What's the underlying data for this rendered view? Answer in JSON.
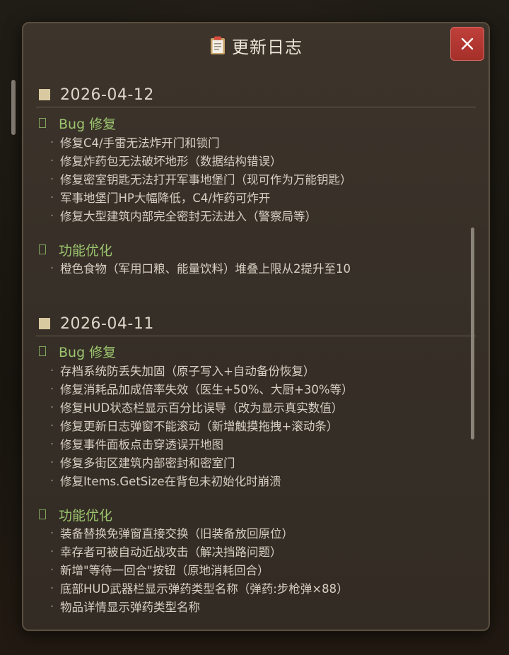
{
  "modal": {
    "title": "更新日志",
    "close_symbol": "✕"
  },
  "icons": {
    "title_icon": "clipboard-icon",
    "close_icon": "close-icon",
    "section_icon": "square-bullet-icon"
  },
  "colors": {
    "panel_bg": "#3a3129",
    "accent_green": "#9cc56e",
    "close_red": "#b3352f",
    "date_square": "#d8c9a0"
  },
  "changelog": [
    {
      "date": "2026-04-12",
      "sections": [
        {
          "title": "Bug 修复",
          "items": [
            "修复C4/手雷无法炸开门和锁门",
            "修复炸药包无法破坏地形（数据结构错误）",
            "修复密室钥匙无法打开军事地堡门（现可作为万能钥匙）",
            "军事地堡门HP大幅降低，C4/炸药可炸开",
            "修复大型建筑内部完全密封无法进入（警察局等）"
          ]
        },
        {
          "title": "功能优化",
          "items": [
            "橙色食物（军用口粮、能量饮料）堆叠上限从2提升至10"
          ]
        }
      ]
    },
    {
      "date": "2026-04-11",
      "sections": [
        {
          "title": "Bug 修复",
          "items": [
            "存档系统防丢失加固（原子写入+自动备份恢复）",
            "修复消耗品加成倍率失效（医生+50%、大厨+30%等）",
            "修复HUD状态栏显示百分比误导（改为显示真实数值）",
            "修复更新日志弹窗不能滚动（新增触摸拖拽+滚动条）",
            "修复事件面板点击穿透误开地图",
            "修复多街区建筑内部密封和密室门",
            "修复Items.GetSize在背包未初始化时崩溃"
          ]
        },
        {
          "title": "功能优化",
          "items": [
            "装备替换免弹窗直接交换（旧装备放回原位）",
            "幸存者可被自动近战攻击（解决挡路问题）",
            "新增\"等待一回合\"按钮（原地消耗回合）",
            "底部HUD武器栏显示弹药类型名称（弹药:步枪弹×88）",
            "物品详情显示弹药类型名称"
          ]
        }
      ]
    }
  ]
}
